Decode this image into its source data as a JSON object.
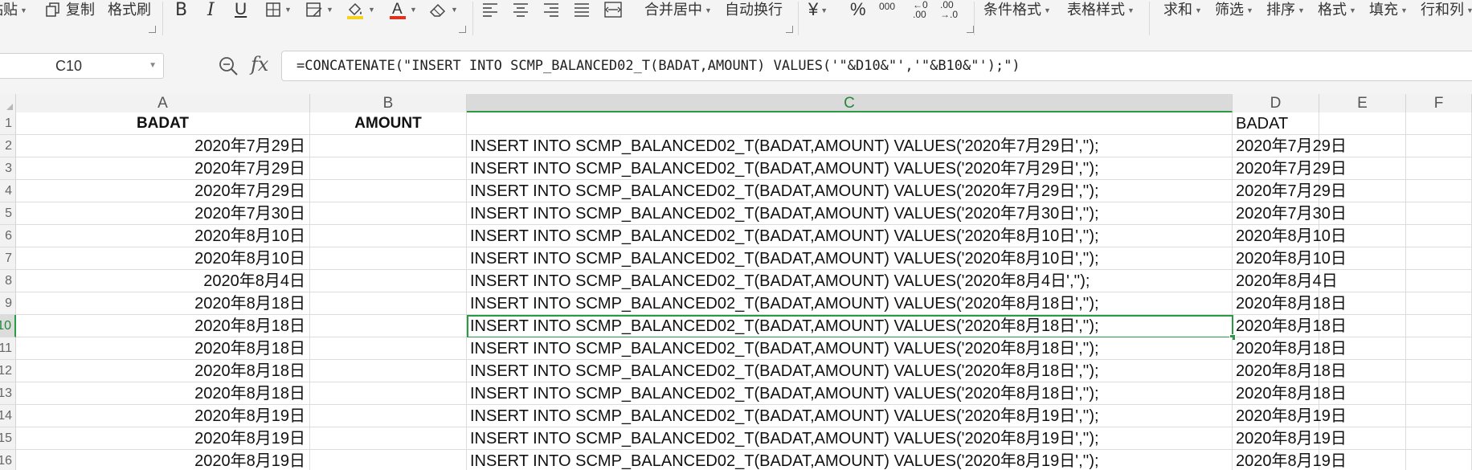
{
  "toolbar": {
    "paste": "粘贴",
    "copy": "复制",
    "format_painter": "格式刷",
    "merge_center": "合并居中",
    "wrap_text": "自动换行",
    "currency_symbol": "¥",
    "percent_symbol": "%",
    "thousands_symbol": "000",
    "inc_decimal_top": "←0",
    "inc_decimal_bottom": ".00",
    "dec_decimal_top": ".00",
    "dec_decimal_bottom": "→.0",
    "conditional_format": "条件格式",
    "table_style": "表格样式",
    "sum": "求和",
    "filter": "筛选",
    "sort": "排序",
    "format": "格式",
    "fill": "填充",
    "rows_cols": "行和列",
    "colors": {
      "highlight": "#f5d21c",
      "font": "#e0301e"
    }
  },
  "formula_bar": {
    "name_box": "C10",
    "fx": "fx",
    "formula": "=CONCATENATE(\"INSERT INTO SCMP_BALANCED02_T(BADAT,AMOUNT) VALUES('\"&D10&\"','\"&B10&\"');\")"
  },
  "grid": {
    "columns": [
      "A",
      "B",
      "C",
      "D",
      "E",
      "F"
    ],
    "active_column": "C",
    "active_row": "10",
    "header_row": {
      "a": "BADAT",
      "b": "AMOUNT",
      "c": "",
      "d": "BADAT"
    },
    "rows": [
      {
        "n": "2",
        "a": "2020年7月29日",
        "b": "",
        "c": "INSERT INTO SCMP_BALANCED02_T(BADAT,AMOUNT) VALUES('2020年7月29日','');",
        "d": "2020年7月29日"
      },
      {
        "n": "3",
        "a": "2020年7月29日",
        "b": "",
        "c": "INSERT INTO SCMP_BALANCED02_T(BADAT,AMOUNT) VALUES('2020年7月29日','');",
        "d": "2020年7月29日"
      },
      {
        "n": "4",
        "a": "2020年7月29日",
        "b": "",
        "c": "INSERT INTO SCMP_BALANCED02_T(BADAT,AMOUNT) VALUES('2020年7月29日','');",
        "d": "2020年7月29日"
      },
      {
        "n": "5",
        "a": "2020年7月30日",
        "b": "",
        "c": "INSERT INTO SCMP_BALANCED02_T(BADAT,AMOUNT) VALUES('2020年7月30日','');",
        "d": "2020年7月30日"
      },
      {
        "n": "6",
        "a": "2020年8月10日",
        "b": "",
        "c": "INSERT INTO SCMP_BALANCED02_T(BADAT,AMOUNT) VALUES('2020年8月10日','');",
        "d": "2020年8月10日"
      },
      {
        "n": "7",
        "a": "2020年8月10日",
        "b": "",
        "c": "INSERT INTO SCMP_BALANCED02_T(BADAT,AMOUNT) VALUES('2020年8月10日','');",
        "d": "2020年8月10日"
      },
      {
        "n": "8",
        "a": "2020年8月4日",
        "b": "",
        "c": "INSERT INTO SCMP_BALANCED02_T(BADAT,AMOUNT) VALUES('2020年8月4日','');",
        "d": "2020年8月4日"
      },
      {
        "n": "9",
        "a": "2020年8月18日",
        "b": "",
        "c": "INSERT INTO SCMP_BALANCED02_T(BADAT,AMOUNT) VALUES('2020年8月18日','');",
        "d": "2020年8月18日"
      },
      {
        "n": "10",
        "a": "2020年8月18日",
        "b": "",
        "c": "INSERT INTO SCMP_BALANCED02_T(BADAT,AMOUNT) VALUES('2020年8月18日','');",
        "d": "2020年8月18日"
      },
      {
        "n": "11",
        "a": "2020年8月18日",
        "b": "",
        "c": "INSERT INTO SCMP_BALANCED02_T(BADAT,AMOUNT) VALUES('2020年8月18日','');",
        "d": "2020年8月18日"
      },
      {
        "n": "12",
        "a": "2020年8月18日",
        "b": "",
        "c": "INSERT INTO SCMP_BALANCED02_T(BADAT,AMOUNT) VALUES('2020年8月18日','');",
        "d": "2020年8月18日"
      },
      {
        "n": "13",
        "a": "2020年8月18日",
        "b": "",
        "c": "INSERT INTO SCMP_BALANCED02_T(BADAT,AMOUNT) VALUES('2020年8月18日','');",
        "d": "2020年8月18日"
      },
      {
        "n": "14",
        "a": "2020年8月19日",
        "b": "",
        "c": "INSERT INTO SCMP_BALANCED02_T(BADAT,AMOUNT) VALUES('2020年8月19日','');",
        "d": "2020年8月19日"
      },
      {
        "n": "15",
        "a": "2020年8月19日",
        "b": "",
        "c": "INSERT INTO SCMP_BALANCED02_T(BADAT,AMOUNT) VALUES('2020年8月19日','');",
        "d": "2020年8月19日"
      },
      {
        "n": "16",
        "a": "2020年8月19日",
        "b": "",
        "c": "INSERT INTO SCMP_BALANCED02_T(BADAT,AMOUNT) VALUES('2020年8月19日','');",
        "d": "2020年8月19日"
      }
    ]
  }
}
